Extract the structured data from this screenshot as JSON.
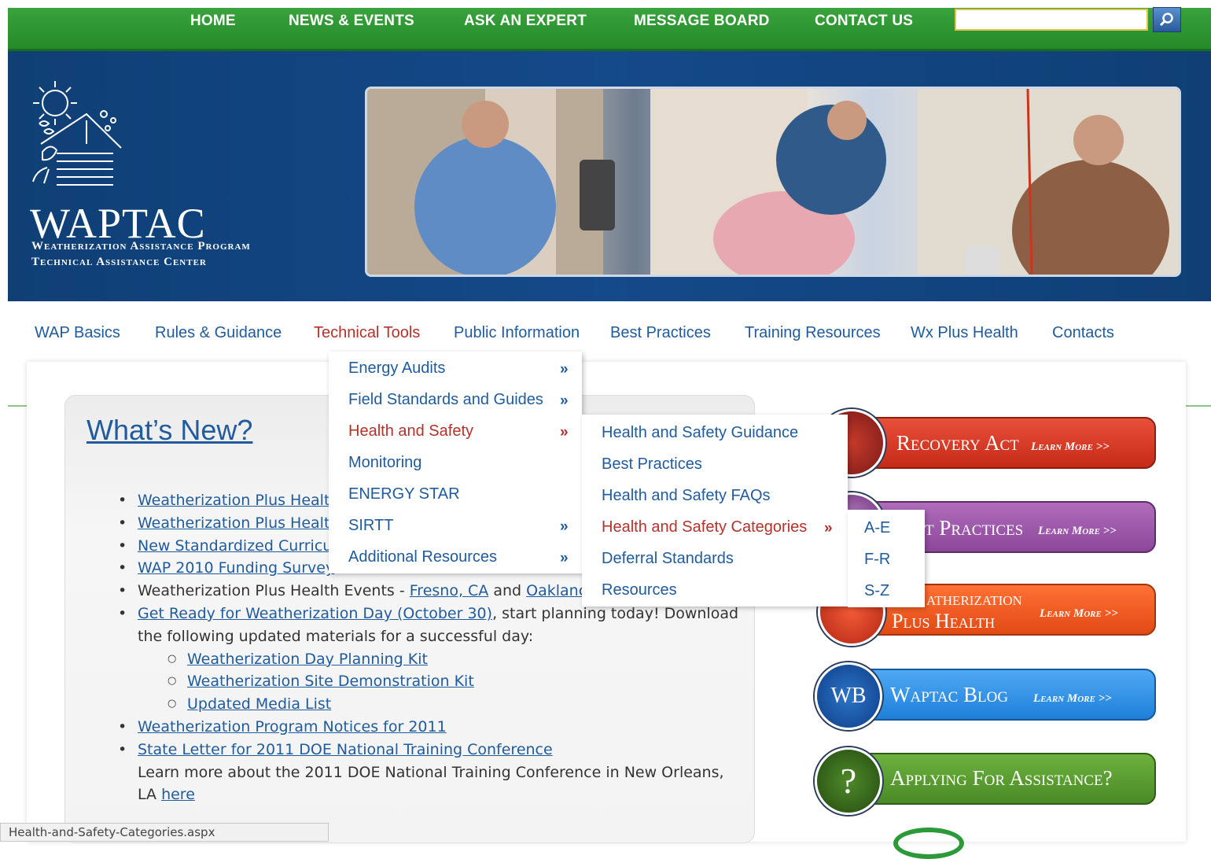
{
  "top_nav": {
    "items": [
      "HOME",
      "NEWS & EVENTS",
      "ASK AN EXPERT",
      "MESSAGE BOARD",
      "CONTACT US"
    ],
    "search_value": ""
  },
  "header": {
    "logo_title": "WAPTAC",
    "logo_line1": "Weatherization Assistance Program",
    "logo_line2": "Technical Assistance Center"
  },
  "main_nav": {
    "items": [
      "WAP Basics",
      "Rules & Guidance",
      "Technical Tools",
      "Public Information",
      "Best Practices",
      "Training Resources",
      "Wx Plus Health",
      "Contacts"
    ],
    "active": "Technical Tools"
  },
  "menu_technical_tools": [
    {
      "label": "Energy Audits",
      "has_sub": true
    },
    {
      "label": "Field Standards and Guides",
      "has_sub": true
    },
    {
      "label": "Health and Safety",
      "has_sub": true,
      "active": true
    },
    {
      "label": "Monitoring",
      "has_sub": false
    },
    {
      "label": "ENERGY STAR",
      "has_sub": false
    },
    {
      "label": "SIRTT",
      "has_sub": true
    },
    {
      "label": "Additional Resources",
      "has_sub": true
    }
  ],
  "menu_health_safety": [
    {
      "label": "Health and Safety Guidance"
    },
    {
      "label": "Best Practices"
    },
    {
      "label": "Health and Safety FAQs"
    },
    {
      "label": "Health and Safety Categories",
      "has_sub": true,
      "active": true
    },
    {
      "label": "Deferral Standards"
    },
    {
      "label": "Resources"
    }
  ],
  "menu_categories": [
    "A-E",
    "F-R",
    "S-Z"
  ],
  "submenu_glyph": "»",
  "whats_new": {
    "title": "What’s New?",
    "items": {
      "i1": "Weatherization Plus Healt",
      "i2": "Weatherization Plus Healt",
      "i3": "New Standardized Curricu",
      "i4": "WAP 2010 Funding Survey",
      "i5_text": "Weatherization Plus Health Events - ",
      "i5_link1": "Fresno, CA",
      "i5_and": " and ",
      "i5_link2": "Oaklanc",
      "i6_link": "Get Ready for Weatherization Day (October 30)",
      "i6_text": ", start planning today! Download the following updated materials for a successful day:",
      "sub1": "Weatherization Day Planning Kit",
      "sub2": "Weatherization Site Demonstration Kit",
      "sub3": "Updated Media List",
      "i7": "Weatherization Program Notices for 2011",
      "i8_link": "State Letter for 2011 DOE National Training Conference",
      "i8_text": "Learn more about the 2011 DOE National Training Conference in New Orleans, LA ",
      "i8_here": "here"
    }
  },
  "promo_buttons": [
    {
      "label": "Recovery Act",
      "more": "Learn More >>",
      "color": "#d8371f"
    },
    {
      "label": "t Practices",
      "more": "Learn More >>",
      "color": "#9b5aa6"
    },
    {
      "label_line1": "atherization",
      "label_line2": "Plus Health",
      "more": "Learn More >>",
      "color": "#ee5a20"
    },
    {
      "label": "Waptac Blog",
      "more": "Learn More >>",
      "badge": "WB",
      "color": "#2f8fe6"
    },
    {
      "label": "Applying For Assistance?",
      "badge": "?",
      "color": "#5b9c35"
    }
  ],
  "status_bar": "Health-and-Safety-Categories.aspx"
}
